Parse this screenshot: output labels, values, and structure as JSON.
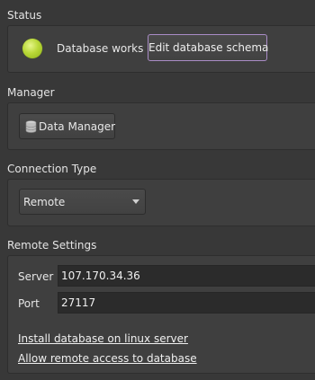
{
  "status": {
    "title": "Status",
    "indicator_color": "#b9d838",
    "text": "Database works",
    "edit_schema_label": "Edit database schema"
  },
  "manager": {
    "title": "Manager",
    "data_manager_label": "Data Manager",
    "icon": "database-icon"
  },
  "connection": {
    "title": "Connection Type",
    "selected": "Remote"
  },
  "remote": {
    "title": "Remote Settings",
    "server_label": "Server",
    "server_value": "107.170.34.36",
    "port_label": "Port",
    "port_value": "27117",
    "install_link": "Install database on linux server",
    "allow_link": "Allow remote access to database"
  },
  "colors": {
    "background": "#383838",
    "group_background": "#3f3f3f",
    "focus_border": "#a98cc6"
  }
}
